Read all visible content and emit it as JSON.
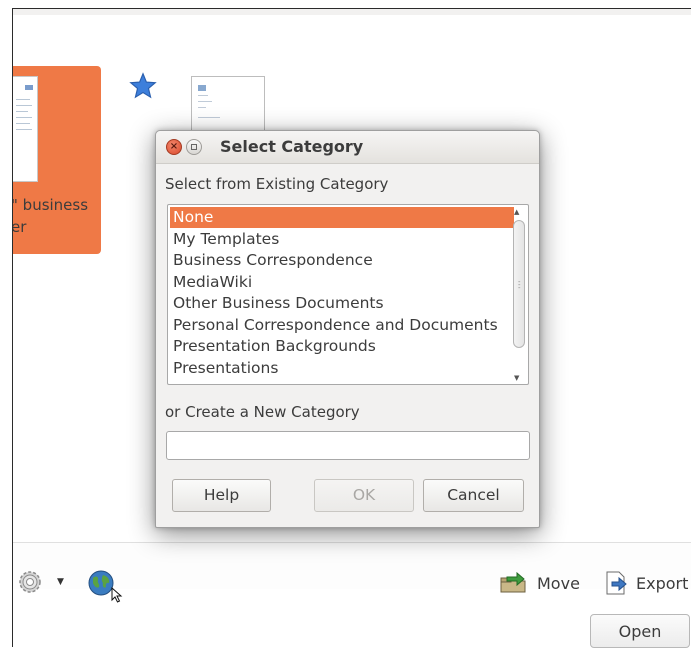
{
  "background_window": {
    "tile_label_line1": "\" business",
    "tile_label_line2": "er",
    "bottom_bar": {
      "move_label": "Move",
      "export_label": "Export",
      "open_label": "Open"
    }
  },
  "dialog": {
    "title": "Select Category",
    "existing_label": "Select from Existing Category",
    "categories": [
      "None",
      "My Templates",
      "Business Correspondence",
      "MediaWiki",
      "Other Business Documents",
      "Personal Correspondence and Documents",
      "Presentation Backgrounds",
      "Presentations"
    ],
    "selected_category": "None",
    "new_label": "or Create a New Category",
    "new_value": "",
    "help_label": "Help",
    "ok_label": "OK",
    "cancel_label": "Cancel"
  },
  "colors": {
    "accent": "#ef7946",
    "dialog_bg": "#f2f1f0",
    "text": "#3c3c3c"
  },
  "icons": [
    "close-icon",
    "maximize-icon",
    "star-icon",
    "gear-icon",
    "chevron-down-icon",
    "globe-icon",
    "cursor-icon",
    "move-icon",
    "export-icon"
  ]
}
